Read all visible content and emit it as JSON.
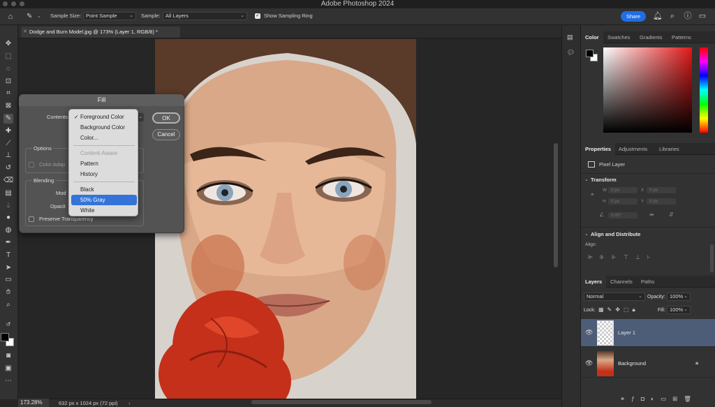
{
  "window": {
    "title": "Adobe Photoshop 2024"
  },
  "options_bar": {
    "sample_size_label": "Sample Size:",
    "sample_size_value": "Point Sample",
    "sample_label": "Sample:",
    "sample_value": "All Layers",
    "sampling_ring_label": "Show Sampling Ring",
    "sampling_ring_checked": true,
    "share_label": "Share"
  },
  "document": {
    "tab_title": "Dodge and Burn Model.jpg @ 173% (Layer 1, RGB/8) *"
  },
  "status_bar": {
    "zoom": "173.28%",
    "doc_info": "632 px x 1024 px (72 ppi)"
  },
  "fill_dialog": {
    "title": "Fill",
    "contents_label": "Contents",
    "options_label": "Options",
    "color_adapt_label": "Color Adap",
    "blending_label": "Blending",
    "mode_label": "Mod",
    "opacity_label": "Opacit",
    "preserve_transparency_label": "Preserve Transparency",
    "ok_label": "OK",
    "cancel_label": "Cancel"
  },
  "contents_menu": {
    "items": [
      {
        "label": "Foreground Color",
        "checked": true
      },
      {
        "label": "Background Color"
      },
      {
        "label": "Color..."
      },
      {
        "label": "Content-Aware",
        "disabled": true
      },
      {
        "label": "Pattern"
      },
      {
        "label": "History"
      },
      {
        "label": "Black"
      },
      {
        "label": "50% Gray",
        "highlighted": true
      },
      {
        "label": "White"
      }
    ],
    "check_mark": "✓"
  },
  "color_panel": {
    "tabs": [
      "Color",
      "Swatches",
      "Gradients",
      "Patterns"
    ],
    "hue_color": "#e01818"
  },
  "properties_panel": {
    "tabs": [
      "Properties",
      "Adjustments",
      "Libraries"
    ],
    "layer_kind": "Pixel Layer",
    "transform_label": "Transform",
    "w_label": "W",
    "h_label": "H",
    "x_label": "X",
    "y_label": "Y",
    "w_value": "0 px",
    "h_value": "0 px",
    "x_value": "0 px",
    "y_value": "0 px",
    "angle_value": "0.00°",
    "align_label": "Align and Distribute",
    "align_sub": "Align:"
  },
  "layers_panel": {
    "tabs": [
      "Layers",
      "Channels",
      "Paths"
    ],
    "blend_mode": "Normal",
    "opacity_label": "Opacity:",
    "opacity_value": "100%",
    "lock_label": "Lock:",
    "fill_label": "Fill:",
    "fill_value": "100%",
    "layers": [
      {
        "name": "Layer 1",
        "selected": true
      },
      {
        "name": "Background",
        "locked": true
      }
    ]
  }
}
